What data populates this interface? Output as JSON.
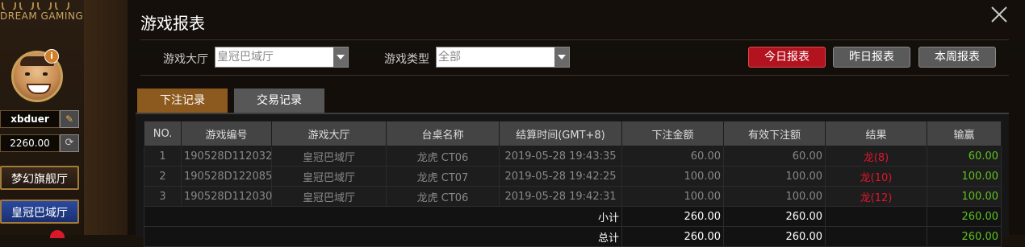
{
  "sidebar": {
    "brand": "DREAM GAMING",
    "username": "xbduer",
    "balance": "2260.00",
    "halls": [
      "梦幻旗舰厅",
      "皇冠巴域厅"
    ]
  },
  "modal": {
    "title": "游戏报表",
    "filters": {
      "hall_label": "游戏大厅",
      "hall_value": "皇冠巴域厅",
      "type_label": "游戏类型",
      "type_value": "全部"
    },
    "report_buttons": {
      "today": "今日报表",
      "yesterday": "昨日报表",
      "week": "本周报表"
    },
    "tabs": {
      "bets": "下注记录",
      "transactions": "交易记录"
    },
    "table": {
      "headers": [
        "NO.",
        "游戏编号",
        "游戏大厅",
        "台桌名称",
        "结算时间(GMT+8)",
        "下注金额",
        "有效下注额",
        "结果",
        "输赢"
      ],
      "rows": [
        {
          "no": "1",
          "game_id": "190528D112032",
          "hall": "皇冠巴域厅",
          "table": "龙虎 CT06",
          "time": "2019-05-28 19:43:35",
          "bet": "60.00",
          "valid_bet": "60.00",
          "result": "龙(8)",
          "win": "60.00"
        },
        {
          "no": "2",
          "game_id": "190528D122085",
          "hall": "皇冠巴域厅",
          "table": "龙虎 CT07",
          "time": "2019-05-28 19:42:25",
          "bet": "100.00",
          "valid_bet": "100.00",
          "result": "龙(10)",
          "win": "100.00"
        },
        {
          "no": "3",
          "game_id": "190528D112030",
          "hall": "皇冠巴域厅",
          "table": "龙虎 CT06",
          "time": "2019-05-28 19:42:31",
          "bet": "100.00",
          "valid_bet": "100.00",
          "result": "龙(12)",
          "win": "100.00"
        }
      ],
      "subtotal": {
        "label": "小计",
        "bet": "260.00",
        "valid_bet": "260.00",
        "win": "260.00"
      },
      "total": {
        "label": "总计",
        "bet": "260.00",
        "valid_bet": "260.00",
        "win": "260.00"
      }
    }
  },
  "colors": {
    "accent_red": "#b3121f",
    "tab_active": "#8c5a1e",
    "result_red": "#e0162b",
    "win_green": "#5fc11f"
  },
  "icons": [
    "edit-icon",
    "refresh-icon",
    "close-icon",
    "info-icon",
    "chevron-down-icon"
  ]
}
